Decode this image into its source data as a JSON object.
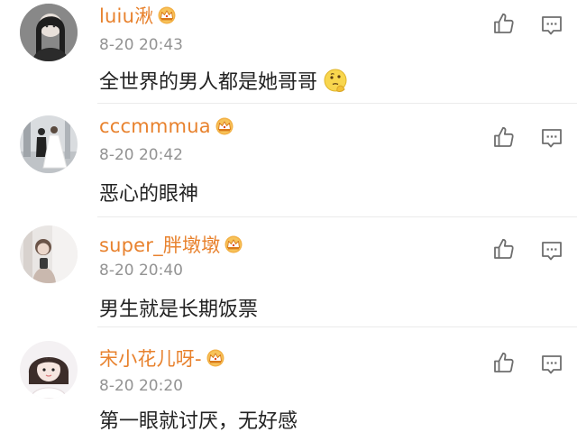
{
  "colors": {
    "username": "#e8822e",
    "timestamp": "#939393",
    "text": "#222222",
    "divider": "#ebebeb",
    "crown": "#f0a93b"
  },
  "comments": [
    {
      "username": "luiu湫",
      "badge_icon": "vip-crown-icon",
      "timestamp": "8-20 20:43",
      "text": "全世界的男人都是她哥哥",
      "emoji_icon": "thinking-face-icon",
      "like_icon": "thumbs-up-icon",
      "reply_icon": "comment-reply-icon"
    },
    {
      "username": "cccmmmua",
      "badge_icon": "vip-crown-icon",
      "timestamp": "8-20 20:42",
      "text": "恶心的眼神",
      "like_icon": "thumbs-up-icon",
      "reply_icon": "comment-reply-icon"
    },
    {
      "username": "super_胖墩墩",
      "badge_icon": "vip-crown-icon",
      "timestamp": "8-20 20:40",
      "text": "男生就是长期饭票",
      "like_icon": "thumbs-up-icon",
      "reply_icon": "comment-reply-icon"
    },
    {
      "username": "宋小花儿呀-",
      "badge_icon": "vip-crown-icon",
      "timestamp": "8-20 20:20",
      "text": "第一眼就讨厌，无好感",
      "like_icon": "thumbs-up-icon",
      "reply_icon": "comment-reply-icon"
    }
  ]
}
